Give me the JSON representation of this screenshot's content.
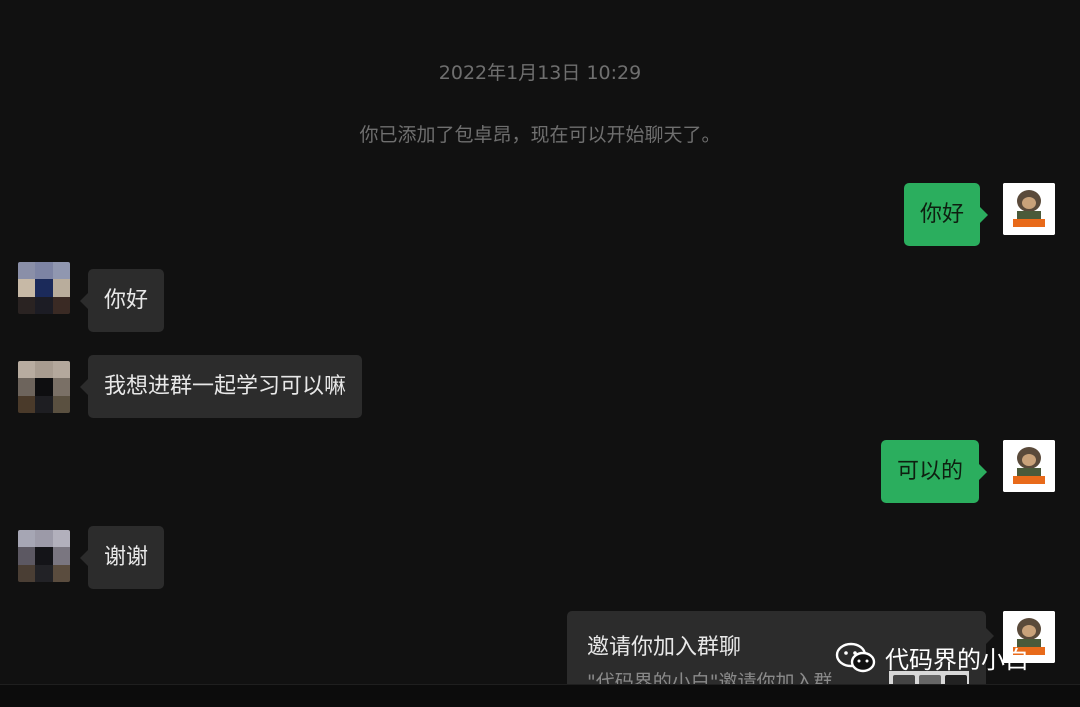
{
  "chat": {
    "timestamp": "2022年1月13日 10:29",
    "system_message": "你已添加了包卓昂，现在可以开始聊天了。",
    "messages": [
      {
        "from": "me",
        "text": "你好"
      },
      {
        "from": "contact",
        "text": "你好"
      },
      {
        "from": "contact",
        "text": "我想进群一起学习可以嘛"
      },
      {
        "from": "me",
        "text": "可以的"
      },
      {
        "from": "contact",
        "text": "谢谢"
      }
    ],
    "invite_card": {
      "title": "邀请你加入群聊",
      "subtitle": "\"代码界的小白\"邀请你加入群"
    }
  },
  "watermark": {
    "icon": "wechat-icon",
    "text": "代码界的小白"
  },
  "colors": {
    "background": "#111111",
    "incoming_bubble": "#2c2c2c",
    "outgoing_bubble": "#2bae5e",
    "system_text": "#6f6f6f"
  }
}
